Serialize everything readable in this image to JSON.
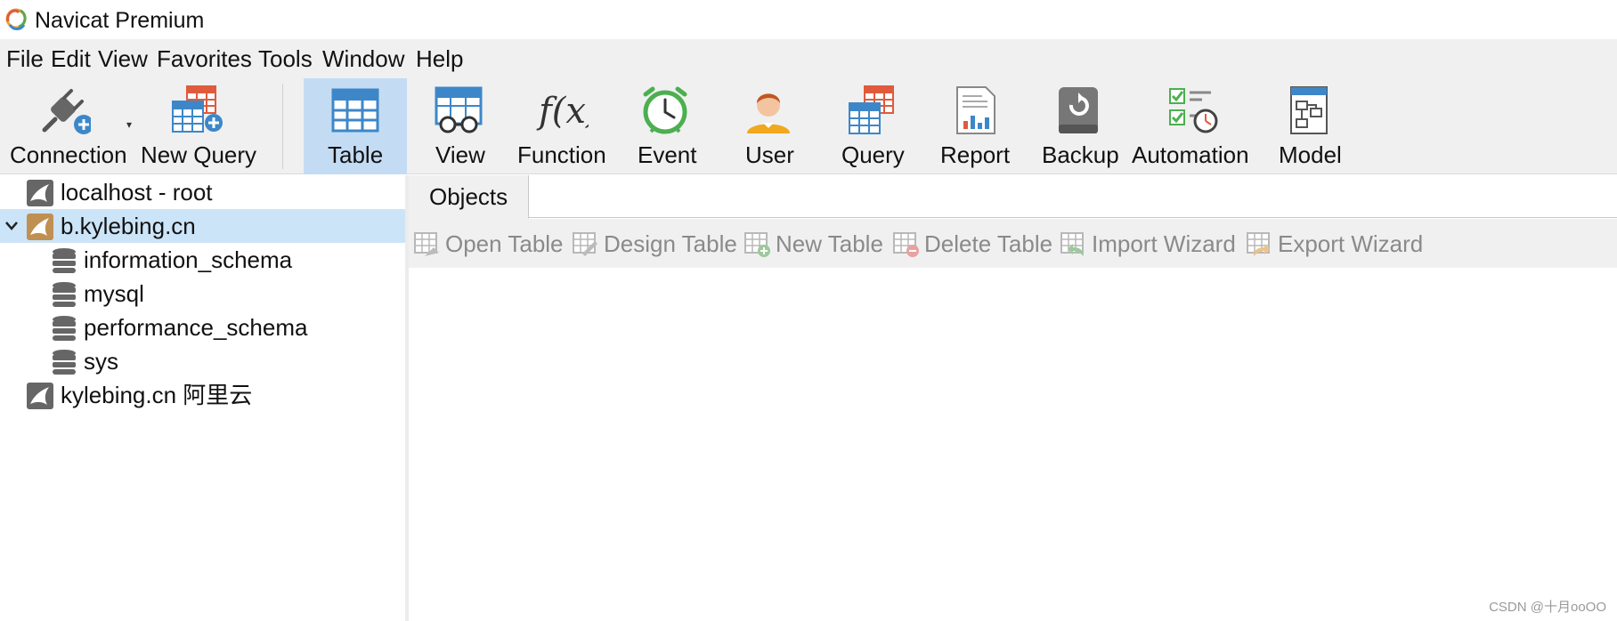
{
  "window": {
    "title": "Navicat Premium"
  },
  "menu": [
    "File",
    "Edit",
    "View",
    "Favorites",
    "Tools",
    "Window",
    "Help"
  ],
  "toolbar": {
    "connection": "Connection",
    "new_query": "New Query",
    "table": "Table",
    "view": "View",
    "function": "Function",
    "function_glyph": "f(x)",
    "event": "Event",
    "user": "User",
    "query": "Query",
    "report": "Report",
    "backup": "Backup",
    "automation": "Automation",
    "model": "Model"
  },
  "tree": [
    {
      "label": "localhost - root"
    },
    {
      "label": "b.kylebing.cn"
    },
    {
      "label": "information_schema"
    },
    {
      "label": "mysql"
    },
    {
      "label": "performance_schema"
    },
    {
      "label": "sys"
    },
    {
      "label": "kylebing.cn 阿里云"
    }
  ],
  "tabs": {
    "objects": "Objects"
  },
  "object_toolbar": {
    "open_table": "Open Table",
    "design_table": "Design Table",
    "new_table": "New Table",
    "delete_table": "Delete Table",
    "import_wizard": "Import Wizard",
    "export_wizard": "Export Wizard"
  },
  "watermark": "CSDN @十月ooOO",
  "colors": {
    "accent": "#3d87c9",
    "selection": "#cce4f7",
    "toolbar_active": "#c4dcf3",
    "chrome": "#f0f0f0"
  }
}
